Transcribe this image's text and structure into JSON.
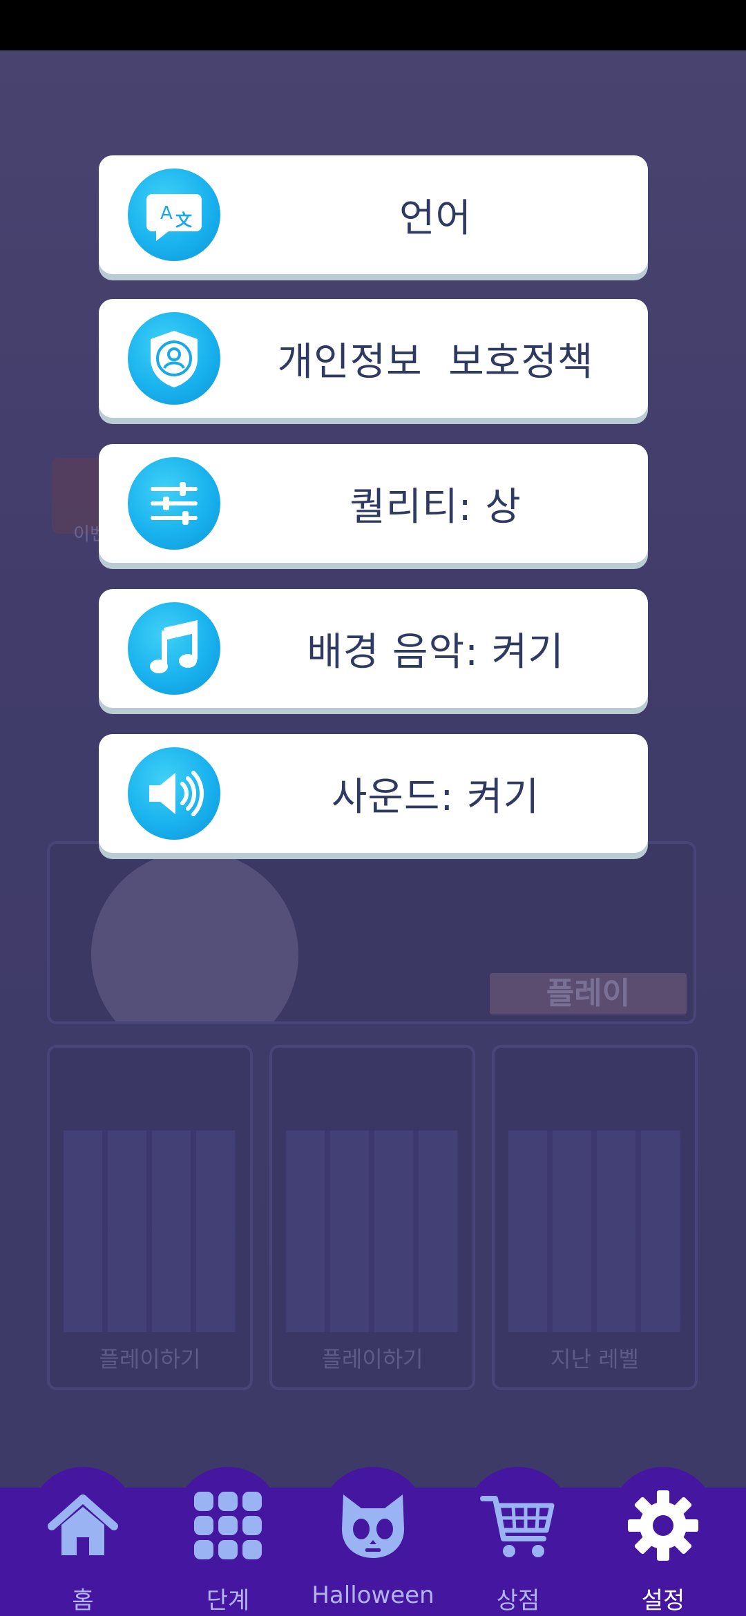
{
  "menu": {
    "items": [
      {
        "label": "언어",
        "icon": "translate-icon"
      },
      {
        "label": "개인정보  보호정책",
        "icon": "privacy-shield-icon"
      },
      {
        "label": "퀄리티: 상",
        "icon": "sliders-icon"
      },
      {
        "label": "배경 음악: 켜기",
        "icon": "music-note-icon"
      },
      {
        "label": "사운드: 켜기",
        "icon": "speaker-icon"
      }
    ]
  },
  "background": {
    "gift_label": "이벤",
    "banner_play": "플레이",
    "cards": [
      "플레이하기",
      "플레이하기",
      "지난 레벨"
    ]
  },
  "nav": {
    "items": [
      {
        "label": "홈",
        "icon": "home-icon"
      },
      {
        "label": "단계",
        "icon": "grid-icon"
      },
      {
        "label": "Halloween",
        "icon": "cat-skull-icon"
      },
      {
        "label": "상점",
        "icon": "cart-icon"
      },
      {
        "label": "설정",
        "icon": "gear-icon",
        "active": true
      }
    ]
  },
  "colors": {
    "accent": "#19b2ee",
    "nav_bg": "#4517a0",
    "nav_label": "#b3b4ee",
    "menu_text": "#2f3a62"
  }
}
